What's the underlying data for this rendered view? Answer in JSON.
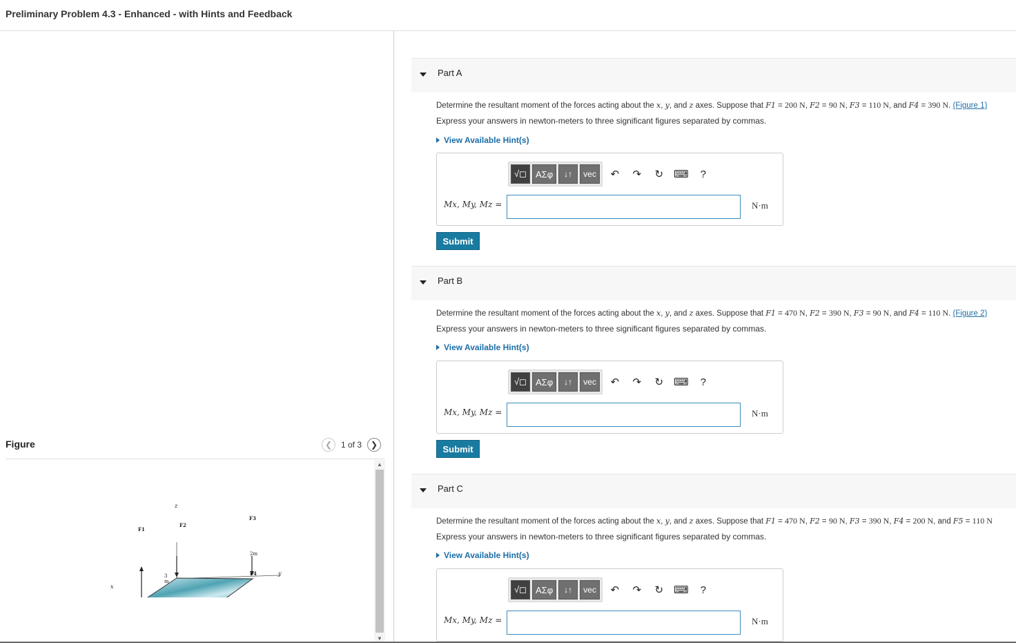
{
  "header": {
    "title": "Preliminary Problem 4.3 - Enhanced - with Hints and Feedback"
  },
  "figure": {
    "label": "Figure",
    "pager": "1 of 3",
    "labels": {
      "z": "z",
      "y": "y",
      "x": "x",
      "F1": "F1",
      "F2": "F2",
      "F3": "F3",
      "F4": "F4",
      "dim_3m": "3 m",
      "dim_2m": "2m"
    }
  },
  "toolbar": {
    "templates": "√◻",
    "greek": "ΑΣφ",
    "arrows": "↓↑",
    "vec": "vec",
    "undo": "↶",
    "redo": "↷",
    "reset": "↻",
    "keyboard": "⌨",
    "help": "?"
  },
  "common": {
    "instructions": "Express your answers in newton-meters to three significant figures separated by commas.",
    "hint_label": "View Available Hint(s)",
    "eq_label": "Mx, My, Mz =",
    "unit": "N·m",
    "submit": "Submit",
    "problem_lead": "Determine the resultant moment of the forces acting about the",
    "x": "x",
    "y": "y",
    "z": "z",
    "axes_text": "axes. Suppose that"
  },
  "parts": [
    {
      "title": "Part A",
      "forces": [
        {
          "name": "F1",
          "value": "200 N"
        },
        {
          "name": "F2",
          "value": "90 N"
        },
        {
          "name": "F3",
          "value": "110 N"
        },
        {
          "name": "F4",
          "value": "390 N"
        }
      ],
      "figure_link": "(Figure 1)"
    },
    {
      "title": "Part B",
      "forces": [
        {
          "name": "F1",
          "value": "470 N"
        },
        {
          "name": "F2",
          "value": "390 N"
        },
        {
          "name": "F3",
          "value": "90 N"
        },
        {
          "name": "F4",
          "value": "110 N"
        }
      ],
      "figure_link": "(Figure 2)"
    },
    {
      "title": "Part C",
      "forces": [
        {
          "name": "F1",
          "value": "470 N"
        },
        {
          "name": "F2",
          "value": "90 N"
        },
        {
          "name": "F3",
          "value": "390 N"
        },
        {
          "name": "F4",
          "value": "200 N"
        },
        {
          "name": "F5",
          "value": "110 N"
        }
      ],
      "figure_link": ""
    }
  ]
}
